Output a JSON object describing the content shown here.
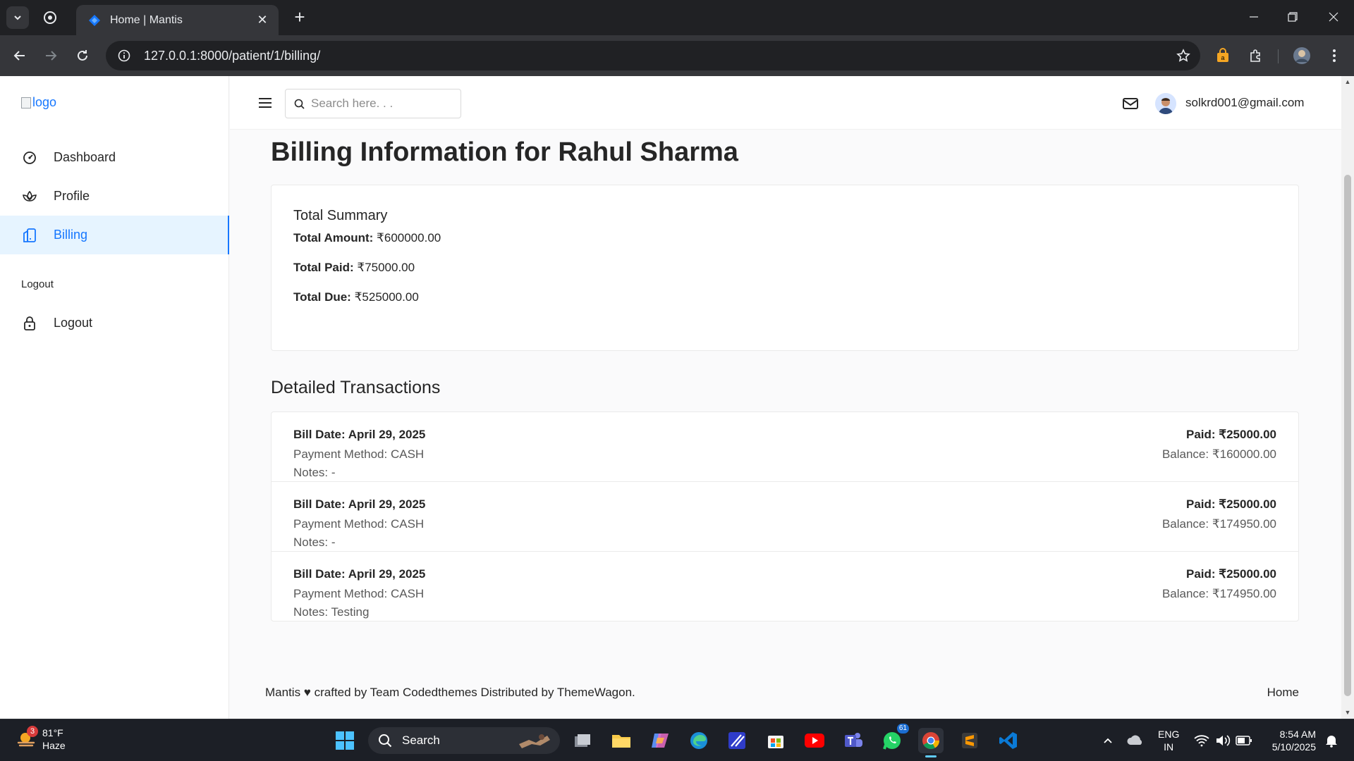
{
  "browser": {
    "tab_title": "Home | Mantis",
    "url": "127.0.0.1:8000/patient/1/billing/"
  },
  "sidebar": {
    "logo_alt": "logo",
    "items": [
      {
        "label": "Dashboard",
        "icon": "dashboard-icon"
      },
      {
        "label": "Profile",
        "icon": "profile-icon"
      },
      {
        "label": "Billing",
        "icon": "billing-icon",
        "active": true
      }
    ],
    "section_label": "Logout",
    "logout_label": "Logout"
  },
  "topbar": {
    "search_placeholder": "Search here. . .",
    "user_email": "solkrd001@gmail.com"
  },
  "main": {
    "title": "Billing Information for Rahul Sharma",
    "summary": {
      "title": "Total Summary",
      "total_amount_label": "Total Amount:",
      "total_amount": "₹600000.00",
      "total_paid_label": "Total Paid:",
      "total_paid": "₹75000.00",
      "total_due_label": "Total Due:",
      "total_due": "₹525000.00"
    },
    "transactions_title": "Detailed Transactions",
    "transactions": [
      {
        "date": "Bill Date: April 29, 2025",
        "method": "Payment Method: CASH",
        "notes": "Notes: -",
        "paid": "Paid: ₹25000.00",
        "balance": "Balance: ₹160000.00"
      },
      {
        "date": "Bill Date: April 29, 2025",
        "method": "Payment Method: CASH",
        "notes": "Notes: -",
        "paid": "Paid: ₹25000.00",
        "balance": "Balance: ₹174950.00"
      },
      {
        "date": "Bill Date: April 29, 2025",
        "method": "Payment Method: CASH",
        "notes": "Notes: Testing",
        "paid": "Paid: ₹25000.00",
        "balance": "Balance: ₹174950.00"
      }
    ]
  },
  "footer": {
    "credit": "Mantis ♥ crafted by Team Codedthemes Distributed by ThemeWagon.",
    "home_link": "Home"
  },
  "taskbar": {
    "weather_badge": "3",
    "temperature": "81°F",
    "condition": "Haze",
    "search_label": "Search",
    "whatsapp_badge": "61",
    "lang_top": "ENG",
    "lang_bottom": "IN",
    "time": "8:54 AM",
    "date": "5/10/2025"
  },
  "colors": {
    "accent": "#1677ff",
    "active_bg": "#e6f4ff",
    "page_bg": "#fafafb"
  }
}
